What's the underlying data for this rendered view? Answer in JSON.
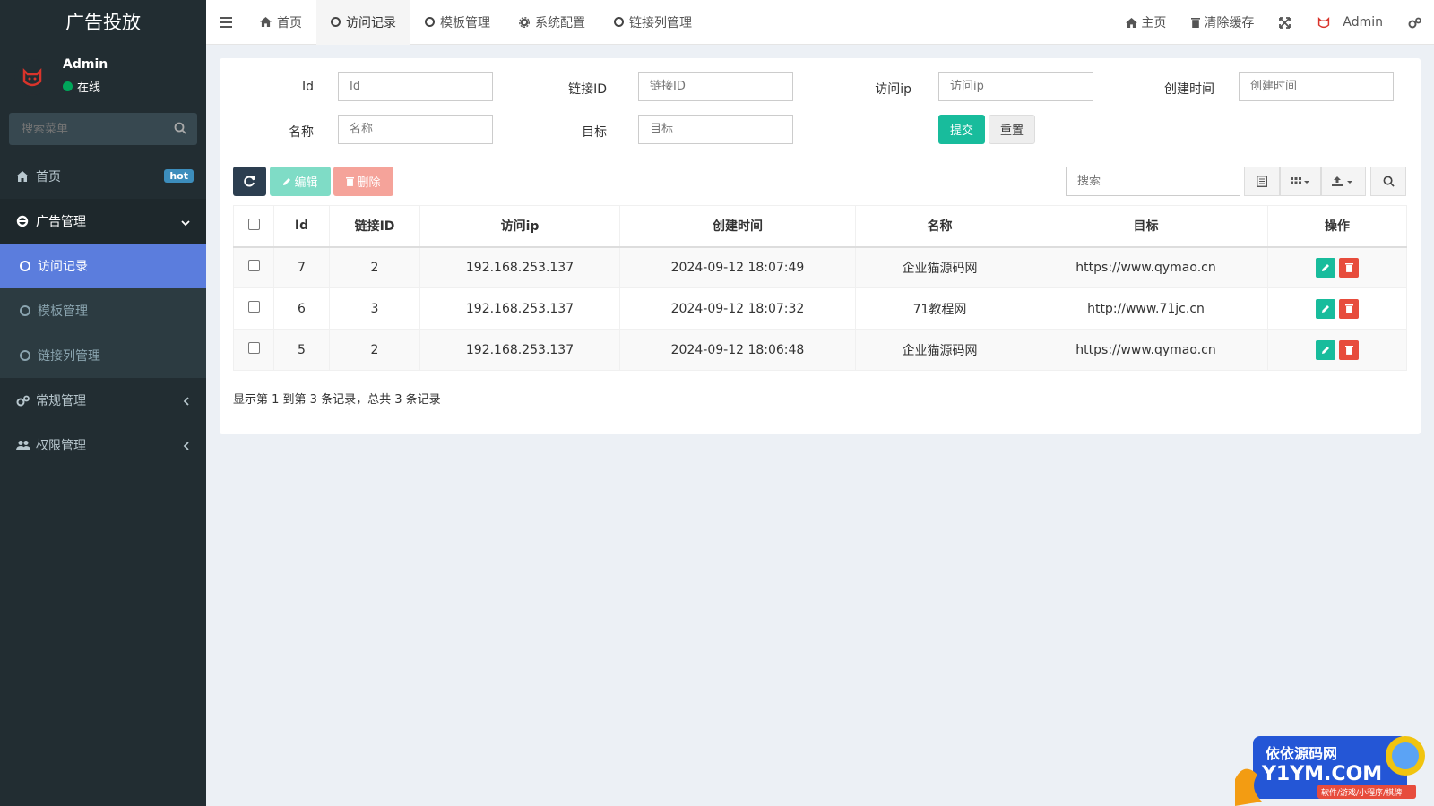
{
  "sidebar": {
    "brand": "广告投放",
    "user": {
      "name": "Admin",
      "status": "在线"
    },
    "search_placeholder": "搜索菜单",
    "menu": [
      {
        "label": "首页",
        "icon": "home-icon",
        "badge": "hot"
      },
      {
        "label": "广告管理",
        "icon": "ie-icon",
        "expanded": true,
        "children": [
          {
            "label": "访问记录",
            "active": true
          },
          {
            "label": "模板管理"
          },
          {
            "label": "链接列管理"
          }
        ]
      },
      {
        "label": "常规管理",
        "icon": "cogs-icon"
      },
      {
        "label": "权限管理",
        "icon": "users-icon"
      }
    ]
  },
  "topbar": {
    "tabs": [
      {
        "label": "首页",
        "icon": "home-icon"
      },
      {
        "label": "访问记录",
        "icon": "circle-icon",
        "active": true
      },
      {
        "label": "模板管理",
        "icon": "circle-icon"
      },
      {
        "label": "系统配置",
        "icon": "gear-icon"
      },
      {
        "label": "链接列管理",
        "icon": "circle-icon"
      }
    ],
    "right": {
      "home": "主页",
      "clear_cache": "清除缓存",
      "user": "Admin"
    }
  },
  "filter": {
    "labels": {
      "id": "Id",
      "link_id": "链接ID",
      "ip": "访问ip",
      "created": "创建时间",
      "name": "名称",
      "target": "目标"
    },
    "placeholders": {
      "id": "Id",
      "link_id": "链接ID",
      "ip": "访问ip",
      "created": "创建时间",
      "name": "名称",
      "target": "目标"
    },
    "submit": "提交",
    "reset": "重置"
  },
  "toolbar": {
    "edit": "编辑",
    "delete": "删除",
    "search_placeholder": "搜索"
  },
  "table": {
    "headers": [
      "Id",
      "链接ID",
      "访问ip",
      "创建时间",
      "名称",
      "目标",
      "操作"
    ],
    "rows": [
      {
        "id": "7",
        "link_id": "2",
        "ip": "192.168.253.137",
        "created": "2024-09-12 18:07:49",
        "name": "企业猫源码网",
        "target": "https://www.qymao.cn"
      },
      {
        "id": "6",
        "link_id": "3",
        "ip": "192.168.253.137",
        "created": "2024-09-12 18:07:32",
        "name": "71教程网",
        "target": "http://www.71jc.cn"
      },
      {
        "id": "5",
        "link_id": "2",
        "ip": "192.168.253.137",
        "created": "2024-09-12 18:06:48",
        "name": "企业猫源码网",
        "target": "https://www.qymao.cn"
      }
    ]
  },
  "pager": {
    "summary": "显示第 1 到第 3 条记录，总共 3 条记录"
  },
  "watermark": {
    "line1": "依依源码网",
    "line2": "Y1YM.COM",
    "line3": "软件/游戏/小程序/棋牌"
  },
  "colors": {
    "sidebar": "#222d32",
    "active_sub": "#5b7ddd",
    "success": "#18bc9c",
    "danger": "#e74c3c"
  }
}
